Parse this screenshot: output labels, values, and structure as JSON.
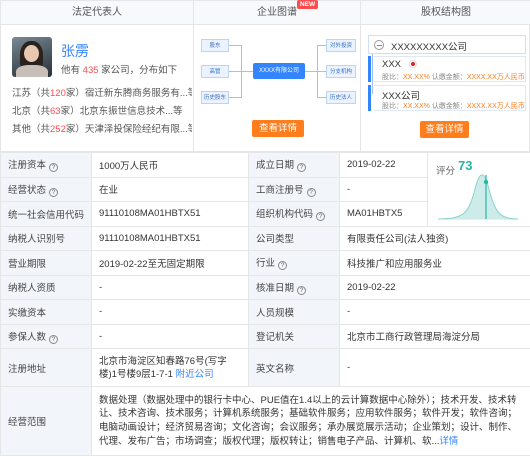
{
  "legal_rep": {
    "heading": "法定代表人",
    "name": "张雳",
    "summary_prefix": "他有",
    "company_count": "435",
    "summary_suffix": "家公司，分布如下",
    "regions": [
      {
        "prefix": "江苏（共",
        "count": "120",
        "mid": "家）",
        "companies": "宿迁新东腾商务服务有...等"
      },
      {
        "prefix": "北京（共",
        "count": "63",
        "mid": "家）",
        "companies": "北京东振世信息技术...等"
      },
      {
        "prefix": "其他（共",
        "count": "252",
        "mid": "家）",
        "companies": "天津泽投保险经纪有限...等"
      }
    ]
  },
  "graph": {
    "heading": "企业图谱",
    "badge": "NEW",
    "left_nodes": [
      "股东",
      "高管",
      "历史股东"
    ],
    "center_node": "XXXX有限公司",
    "right_nodes": [
      "对外投资",
      "分支机构",
      "历史法人"
    ],
    "button": "查看详情"
  },
  "equity": {
    "heading": "股权结构图",
    "company": "XXXXXXXXX公司",
    "holders": [
      {
        "name": "XXX",
        "ratio_label": "股比：",
        "ratio": "XX.XX%",
        "capital_label": "认缴金额：",
        "capital": "XXXX.XX万人民币"
      },
      {
        "name": "XXX公司",
        "ratio_label": "股比：",
        "ratio": "XX.XX%",
        "capital_label": "认缴金额：",
        "capital": "XXXX.XX万人民币"
      }
    ],
    "button": "查看详情"
  },
  "score": {
    "label": "评分",
    "value": "73",
    "value_num": 73
  },
  "table": {
    "reg_capital_label": "注册资本",
    "reg_capital": "1000万人民币",
    "established_label": "成立日期",
    "established": "2019-02-22",
    "status_label": "经营状态",
    "status": "在业",
    "biz_reg_no_label": "工商注册号",
    "biz_reg_no": "-",
    "credit_code_label": "统一社会信用代码",
    "credit_code": "91110108MA01HBTX51",
    "org_code_label": "组织机构代码",
    "org_code": "MA01HBTX5",
    "tax_id_label": "纳税人识别号",
    "tax_id": "91110108MA01HBTX51",
    "company_type_label": "公司类型",
    "company_type": "有限责任公司(法人独资)",
    "term_label": "营业期限",
    "term": "2019-02-22至无固定期限",
    "industry_label": "行业",
    "industry": "科技推广和应用服务业",
    "taxpayer_qual_label": "纳税人资质",
    "taxpayer_qual": "-",
    "approval_date_label": "核准日期",
    "approval_date": "2019-02-22",
    "paid_capital_label": "实缴资本",
    "paid_capital": "-",
    "staff_size_label": "人员规模",
    "staff_size": "-",
    "insured_label": "参保人数",
    "insured": "-",
    "reg_authority_label": "登记机关",
    "reg_authority": "北京市工商行政管理局海淀分局",
    "address_label": "注册地址",
    "address": "北京市海淀区知春路76号(写字楼)1号楼9层1-7-1",
    "address_link": "附近公司",
    "english_name_label": "英文名称",
    "english_name": "-",
    "scope_label": "经营范围",
    "scope": "数据处理（数据处理中的银行卡中心、PUE值在1.4以上的云计算数据中心除外）；技术开发、技术转让、技术咨询、技术服务；计算机系统服务；基础软件服务；应用软件服务；软件开发；软件咨询；电脑动画设计；经济贸易咨询；文化咨询；会议服务；承办展览展示活动；企业策划；设计、制作、代理、发布广告；市场调查；版权代理；版权转让；销售电子产品、计算机、软...",
    "scope_link": "详情"
  }
}
